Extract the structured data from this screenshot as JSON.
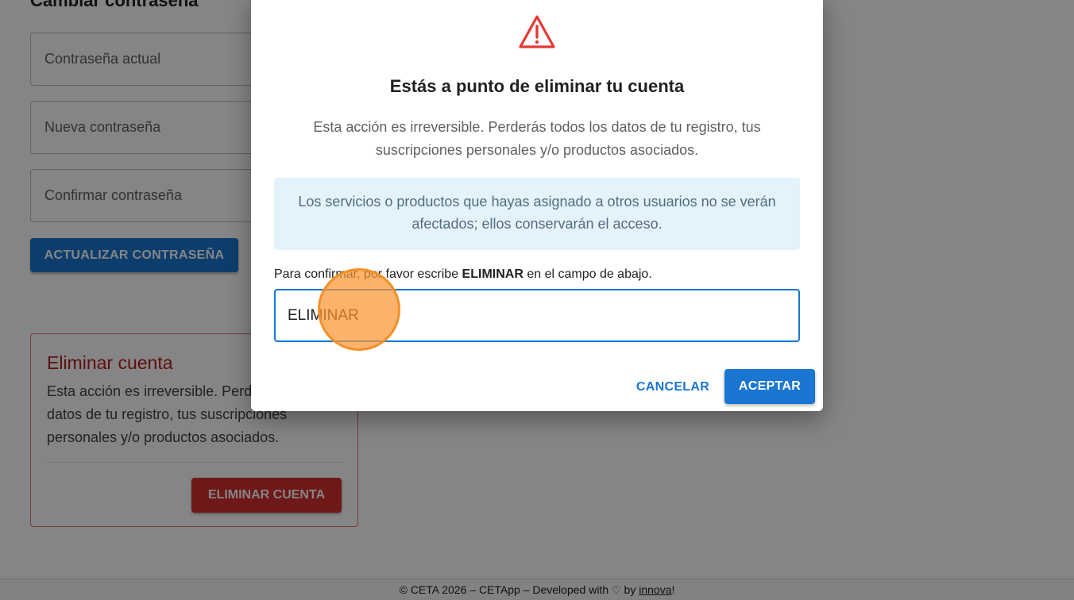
{
  "background": {
    "section_title": "Cambiar contraseña",
    "fields": {
      "current": "Contraseña actual",
      "new": "Nueva contraseña",
      "confirm": "Confirmar contraseña"
    },
    "update_button": "ACTUALIZAR CONTRASEÑA",
    "delete_card": {
      "title": "Eliminar cuenta",
      "text": "Esta acción es irreversible. Perderás todos los datos de tu registro, tus suscripciones personales y/o productos asociados.",
      "button": "ELIMINAR CUENTA"
    }
  },
  "footer": {
    "prefix": "© CETA 2026 – CETApp – Developed with",
    "heart": "♡",
    "by": "by",
    "link": "innova",
    "suffix": "!"
  },
  "dialog": {
    "title": "Estás a punto de eliminar tu cuenta",
    "text": "Esta acción es irreversible. Perderás todos los datos de tu registro, tus suscripciones personales y/o productos asociados.",
    "info": "Los servicios o productos que hayas asignado a otros usuarios no se verán afectados; ellos conservarán el acceso.",
    "confirm_prefix": "Para confirmar, por favor escribe",
    "confirm_keyword": "ELIMINAR",
    "confirm_suffix": "en el campo de abajo.",
    "input_value": "ELIMINAR",
    "cancel_label": "CANCELAR",
    "accept_label": "ACEPTAR"
  },
  "colors": {
    "primary": "#1976d2",
    "danger": "#d32f2f",
    "warning_icon": "#e53935",
    "info_bg": "#e3f2fb",
    "click_indicator": "#f39029"
  },
  "icons": {
    "warning": "warning-triangle-icon"
  }
}
